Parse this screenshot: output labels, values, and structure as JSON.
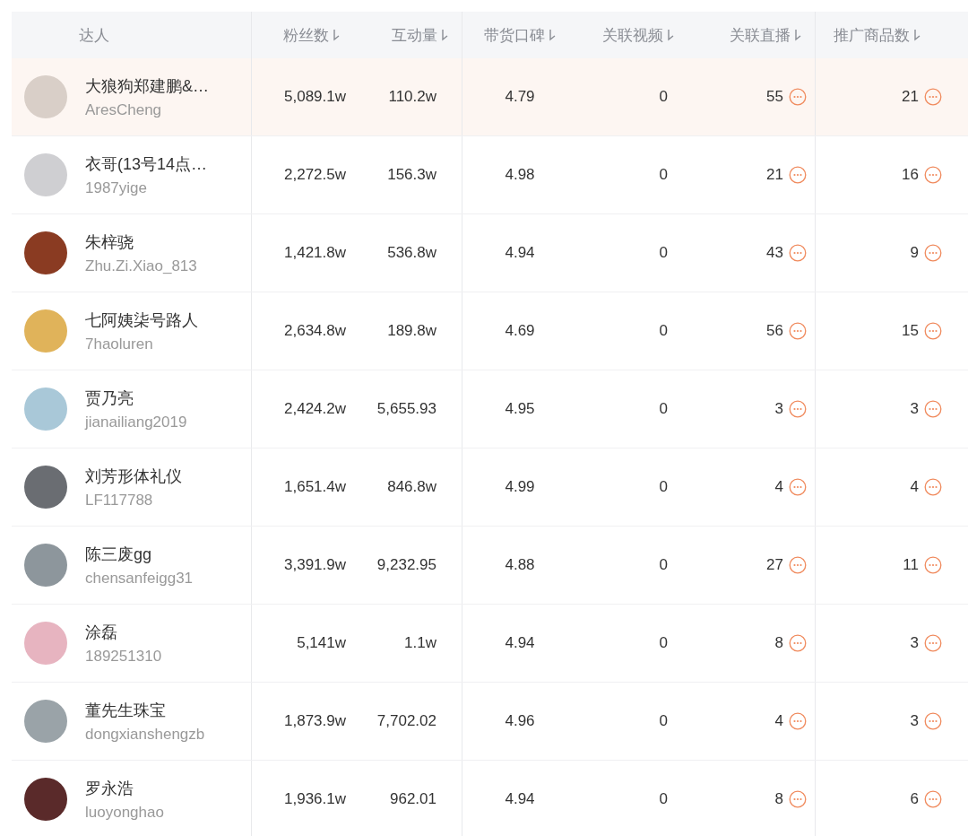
{
  "table": {
    "columns": [
      {
        "label": "达人",
        "sortable": false
      },
      {
        "label": "粉丝数",
        "sortable": true
      },
      {
        "label": "互动量",
        "sortable": true
      },
      {
        "label": "带货口碑",
        "sortable": true
      },
      {
        "label": "关联视频",
        "sortable": true
      },
      {
        "label": "关联直播",
        "sortable": true
      },
      {
        "label": "推广商品数",
        "sortable": true
      }
    ],
    "rows": [
      {
        "selected": true,
        "name": "大狼狗郑建鹏&…",
        "handle": "AresCheng",
        "fans": "5,089.1w",
        "interactions": "110.2w",
        "rating": "4.79",
        "videos": "0",
        "lives": "55",
        "products": "21"
      },
      {
        "selected": false,
        "name": "衣哥(13号14点…",
        "handle": "1987yige",
        "fans": "2,272.5w",
        "interactions": "156.3w",
        "rating": "4.98",
        "videos": "0",
        "lives": "21",
        "products": "16"
      },
      {
        "selected": false,
        "name": "朱梓骁",
        "handle": "Zhu.Zi.Xiao_813",
        "fans": "1,421.8w",
        "interactions": "536.8w",
        "rating": "4.94",
        "videos": "0",
        "lives": "43",
        "products": "9"
      },
      {
        "selected": false,
        "name": "七阿姨柒号路人",
        "handle": "7haoluren",
        "fans": "2,634.8w",
        "interactions": "189.8w",
        "rating": "4.69",
        "videos": "0",
        "lives": "56",
        "products": "15"
      },
      {
        "selected": false,
        "name": "贾乃亮",
        "handle": "jianailiang2019",
        "fans": "2,424.2w",
        "interactions": "5,655.93",
        "rating": "4.95",
        "videos": "0",
        "lives": "3",
        "products": "3"
      },
      {
        "selected": false,
        "name": "刘芳形体礼仪",
        "handle": "LF117788",
        "fans": "1,651.4w",
        "interactions": "846.8w",
        "rating": "4.99",
        "videos": "0",
        "lives": "4",
        "products": "4"
      },
      {
        "selected": false,
        "name": "陈三废gg",
        "handle": "chensanfeigg31",
        "fans": "3,391.9w",
        "interactions": "9,232.95",
        "rating": "4.88",
        "videos": "0",
        "lives": "27",
        "products": "11"
      },
      {
        "selected": false,
        "name": "涂磊",
        "handle": "189251310",
        "fans": "5,141w",
        "interactions": "1.1w",
        "rating": "4.94",
        "videos": "0",
        "lives": "8",
        "products": "3"
      },
      {
        "selected": false,
        "name": "董先生珠宝",
        "handle": "dongxianshengzb",
        "fans": "1,873.9w",
        "interactions": "7,702.02",
        "rating": "4.96",
        "videos": "0",
        "lives": "4",
        "products": "3"
      },
      {
        "selected": false,
        "name": "罗永浩",
        "handle": "luoyonghao",
        "fans": "1,936.1w",
        "interactions": "962.01",
        "rating": "4.94",
        "videos": "0",
        "lives": "8",
        "products": "6"
      }
    ]
  }
}
